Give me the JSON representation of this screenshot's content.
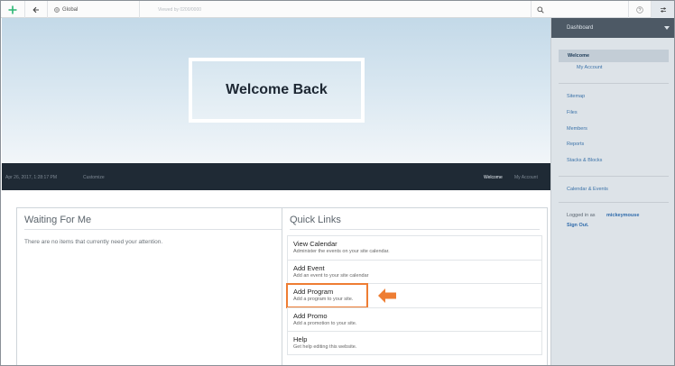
{
  "toolbar": {
    "global_label": "Global",
    "path_text": "Viewed by 0200/0000"
  },
  "hero": {
    "title": "Welcome Back"
  },
  "navbar": {
    "date": "Apr 26, 2017, 1:28:17 PM",
    "customize": "Customize",
    "welcome": "Welcome",
    "my_account": "My Account"
  },
  "waiting": {
    "title": "Waiting For Me",
    "empty_text": "There are no items that currently need your attention."
  },
  "quick_links": {
    "title": "Quick Links",
    "items": [
      {
        "label": "View Calendar",
        "desc": "Administer the events on your site calendar."
      },
      {
        "label": "Add Event",
        "desc": "Add an event to your site calendar"
      },
      {
        "label": "Add Program",
        "desc": "Add a program to your site."
      },
      {
        "label": "Add Promo",
        "desc": "Add a promotion to your site."
      },
      {
        "label": "Help",
        "desc": "Get help editing this website."
      }
    ],
    "highlight_color": "#ee7d33"
  },
  "sidebar": {
    "header": "Dashboard",
    "welcome": "Welcome",
    "my_account": "My Account",
    "links": [
      "Sitemap",
      "Files",
      "Members",
      "Reports",
      "Stacks & Blocks"
    ],
    "calendar": "Calendar & Events",
    "logged_in_as": "Logged in as",
    "username": "mickeymouse",
    "sign_out": "Sign Out."
  },
  "colors": {
    "accent": "#ee7d33",
    "nav_bg": "#1f2a35",
    "sidebar_bg": "#dde3e8",
    "link": "#3b72a8",
    "logo_green": "#2bb673"
  }
}
